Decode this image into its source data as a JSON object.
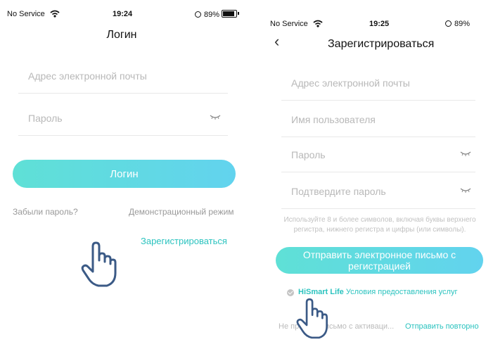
{
  "login_screen": {
    "status": {
      "carrier": "No Service",
      "time": "19:24",
      "battery": "89%"
    },
    "title": "Логин",
    "email_placeholder": "Адрес электронной почты",
    "password_placeholder": "Пароль",
    "login_button": "Логин",
    "forgot_password": "Забыли пароль?",
    "demo_mode": "Демонстрационный режим",
    "register_link": "Зарегистрироваться"
  },
  "register_screen": {
    "status": {
      "carrier": "No Service",
      "time": "19:25",
      "battery": "89%"
    },
    "title": "Зарегистрироваться",
    "email_placeholder": "Адрес электронной почты",
    "username_placeholder": "Имя пользователя",
    "password_placeholder": "Пароль",
    "confirm_password_placeholder": "Подтвердите пароль",
    "password_hint": "Используйте 8 и более символов, включая буквы верхнего регистра, нижнего регистра и цифры (или символы).",
    "send_button_line1": "Отправить электронное письмо с",
    "send_button_line2": "регистрацией",
    "terms_brand": "HiSmart Life",
    "terms_text": "Условия предоставления услуг",
    "no_email_text": "Не пришло письмо с активаци...",
    "resend_link": "Отправить повторно"
  },
  "icons": {
    "wifi": "wifi-icon",
    "battery": "battery-icon",
    "orientation_lock": "orientation-lock-icon",
    "eye": "eye-closed-icon",
    "back": "chevron-left-icon",
    "hand_pointer": "hand-pointer-icon",
    "check": "check-circle-icon"
  },
  "colors": {
    "accent": "#2bc3bf",
    "button_start": "#5fe0d6",
    "button_end": "#62d3ee"
  }
}
